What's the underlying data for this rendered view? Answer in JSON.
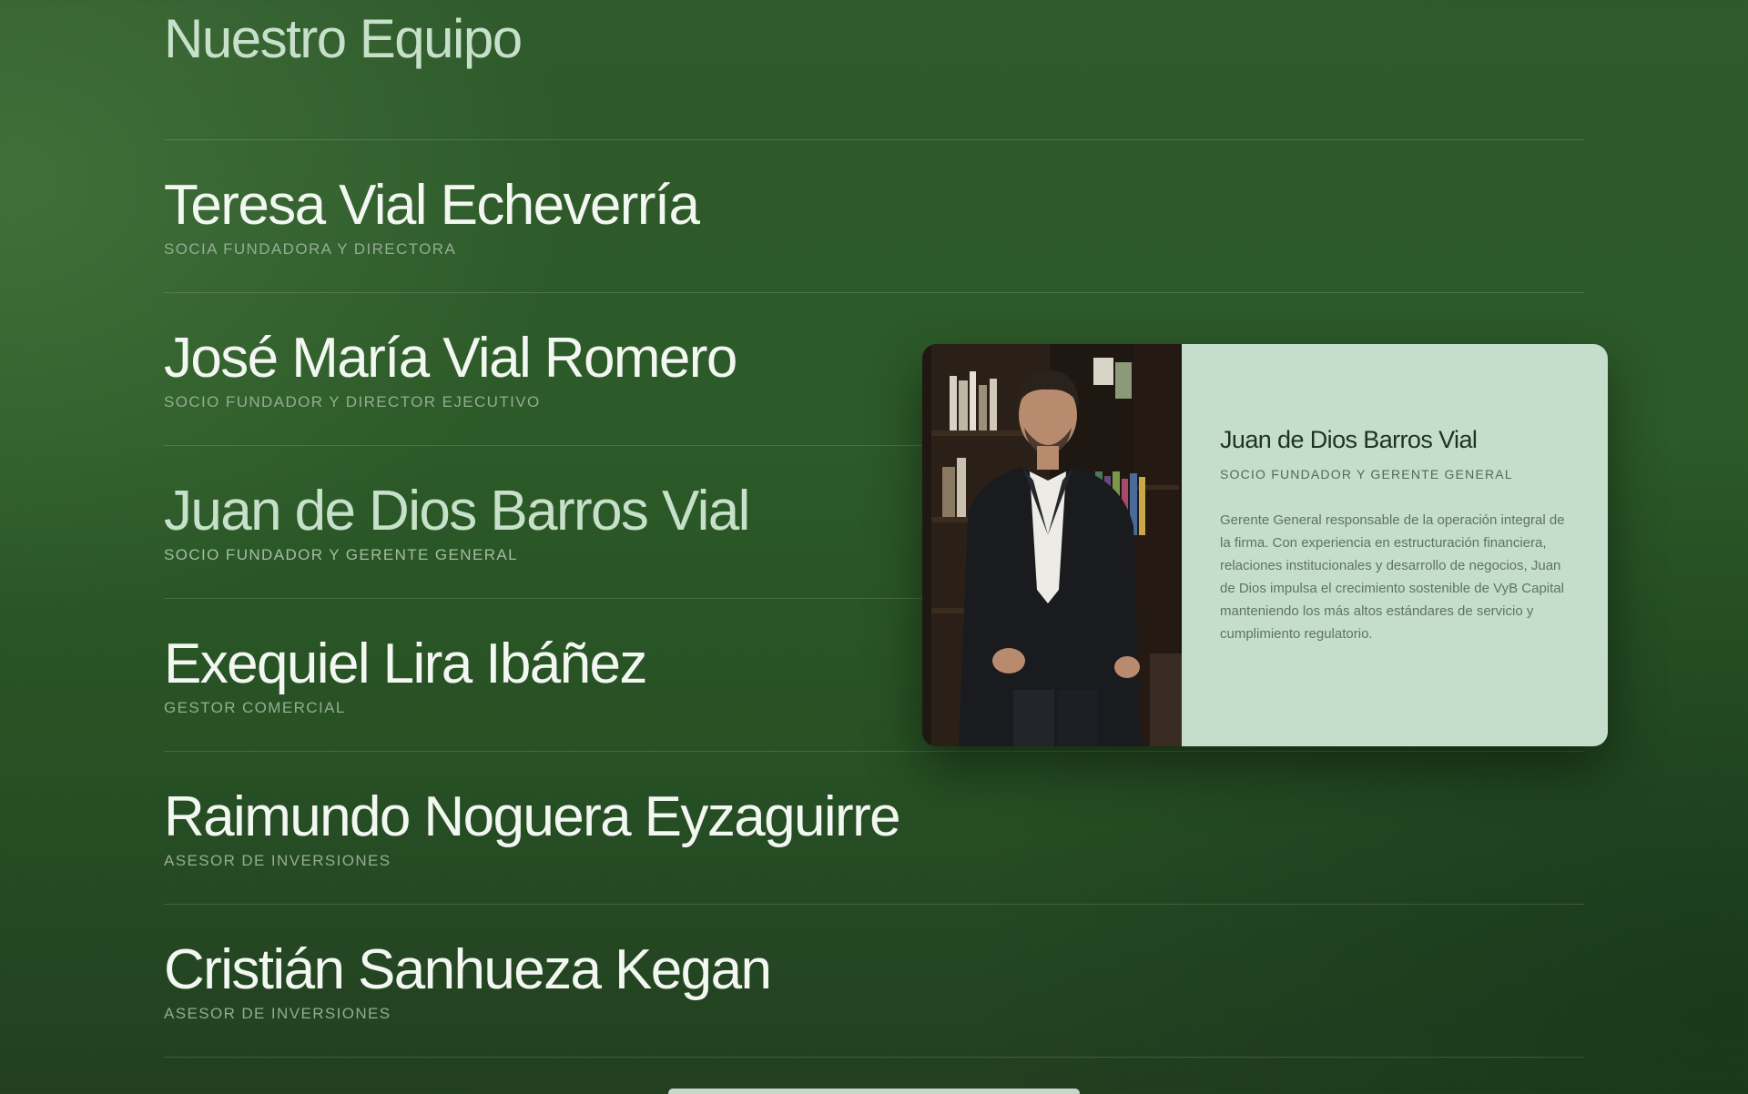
{
  "section": {
    "title": "Nuestro Equipo"
  },
  "members": [
    {
      "name": "Teresa Vial Echeverría",
      "role": "SOCIA FUNDADORA Y DIRECTORA"
    },
    {
      "name": "José María Vial Romero",
      "role": "SOCIO FUNDADOR Y DIRECTOR EJECUTIVO"
    },
    {
      "name": "Juan de Dios Barros Vial",
      "role": "SOCIO FUNDADOR Y GERENTE GENERAL"
    },
    {
      "name": "Exequiel Lira Ibáñez",
      "role": "GESTOR COMERCIAL"
    },
    {
      "name": "Raimundo Noguera Eyzaguirre",
      "role": "ASESOR DE INVERSIONES"
    },
    {
      "name": "Cristián Sanhueza Kegan",
      "role": "ASESOR DE INVERSIONES"
    }
  ],
  "profile_card": {
    "name": "Juan de Dios Barros Vial",
    "role": "SOCIO FUNDADOR Y GERENTE GENERAL",
    "bio": "Gerente General responsable de la operación integral de la firma. Con experiencia en estructuración financiera, relaciones institucionales y desarrollo de negocios, Juan de Dios impulsa el crecimiento sostenible de VyB Capital manteniendo los más altos estándares de servicio y cumplimiento regulatorio."
  }
}
